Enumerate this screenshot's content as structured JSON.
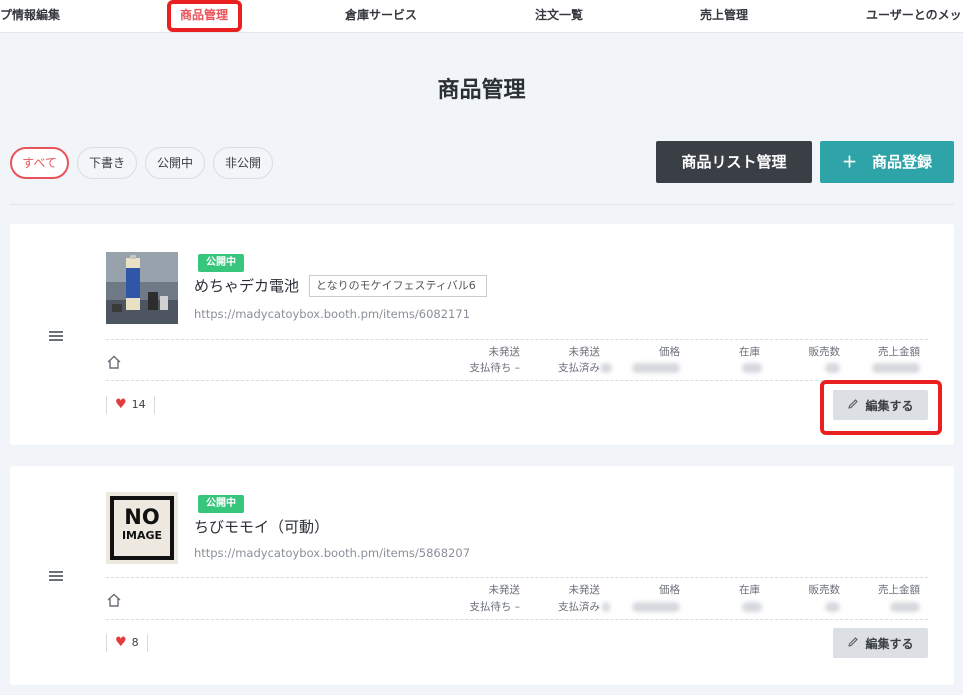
{
  "nav": {
    "items": [
      {
        "label": "プ情報編集"
      },
      {
        "label": "商品管理"
      },
      {
        "label": "倉庫サービス"
      },
      {
        "label": "注文一覧"
      },
      {
        "label": "売上管理"
      },
      {
        "label": "ユーザーとのメッ"
      }
    ],
    "active_index": 1
  },
  "page": {
    "title": "商品管理"
  },
  "filters": [
    {
      "label": "すべて"
    },
    {
      "label": "下書き"
    },
    {
      "label": "公開中"
    },
    {
      "label": "非公開"
    }
  ],
  "actions": {
    "list_manage": "商品リスト管理",
    "add_product": "＋　商品登録"
  },
  "stat_headers": {
    "unshipped": "未発送",
    "payment_waiting": "支払待ち –",
    "paid": "支払済み",
    "price": "価格",
    "stock": "在庫",
    "sales_count": "販売数",
    "sales_amount": "売上金額"
  },
  "products": [
    {
      "status": "公開中",
      "name": "めちゃデカ電池",
      "tag": "となりのモケイフェスティバル6",
      "url": "https://madycatoybox.booth.pm/items/6082171",
      "likes": "14",
      "edit_label": "編集する"
    },
    {
      "status": "公開中",
      "name": "ちびモモイ（可動）",
      "url": "https://madycatoybox.booth.pm/items/5868207",
      "no_image_line1": "NO",
      "no_image_line2": "IMAGE",
      "likes": "8",
      "edit_label": "編集する"
    }
  ],
  "colors": {
    "accent": "#e8545a",
    "teal": "#2ea3a8",
    "dark": "#3a3e45",
    "badge_green": "#38c57c",
    "highlight": "#ea1f1f"
  }
}
